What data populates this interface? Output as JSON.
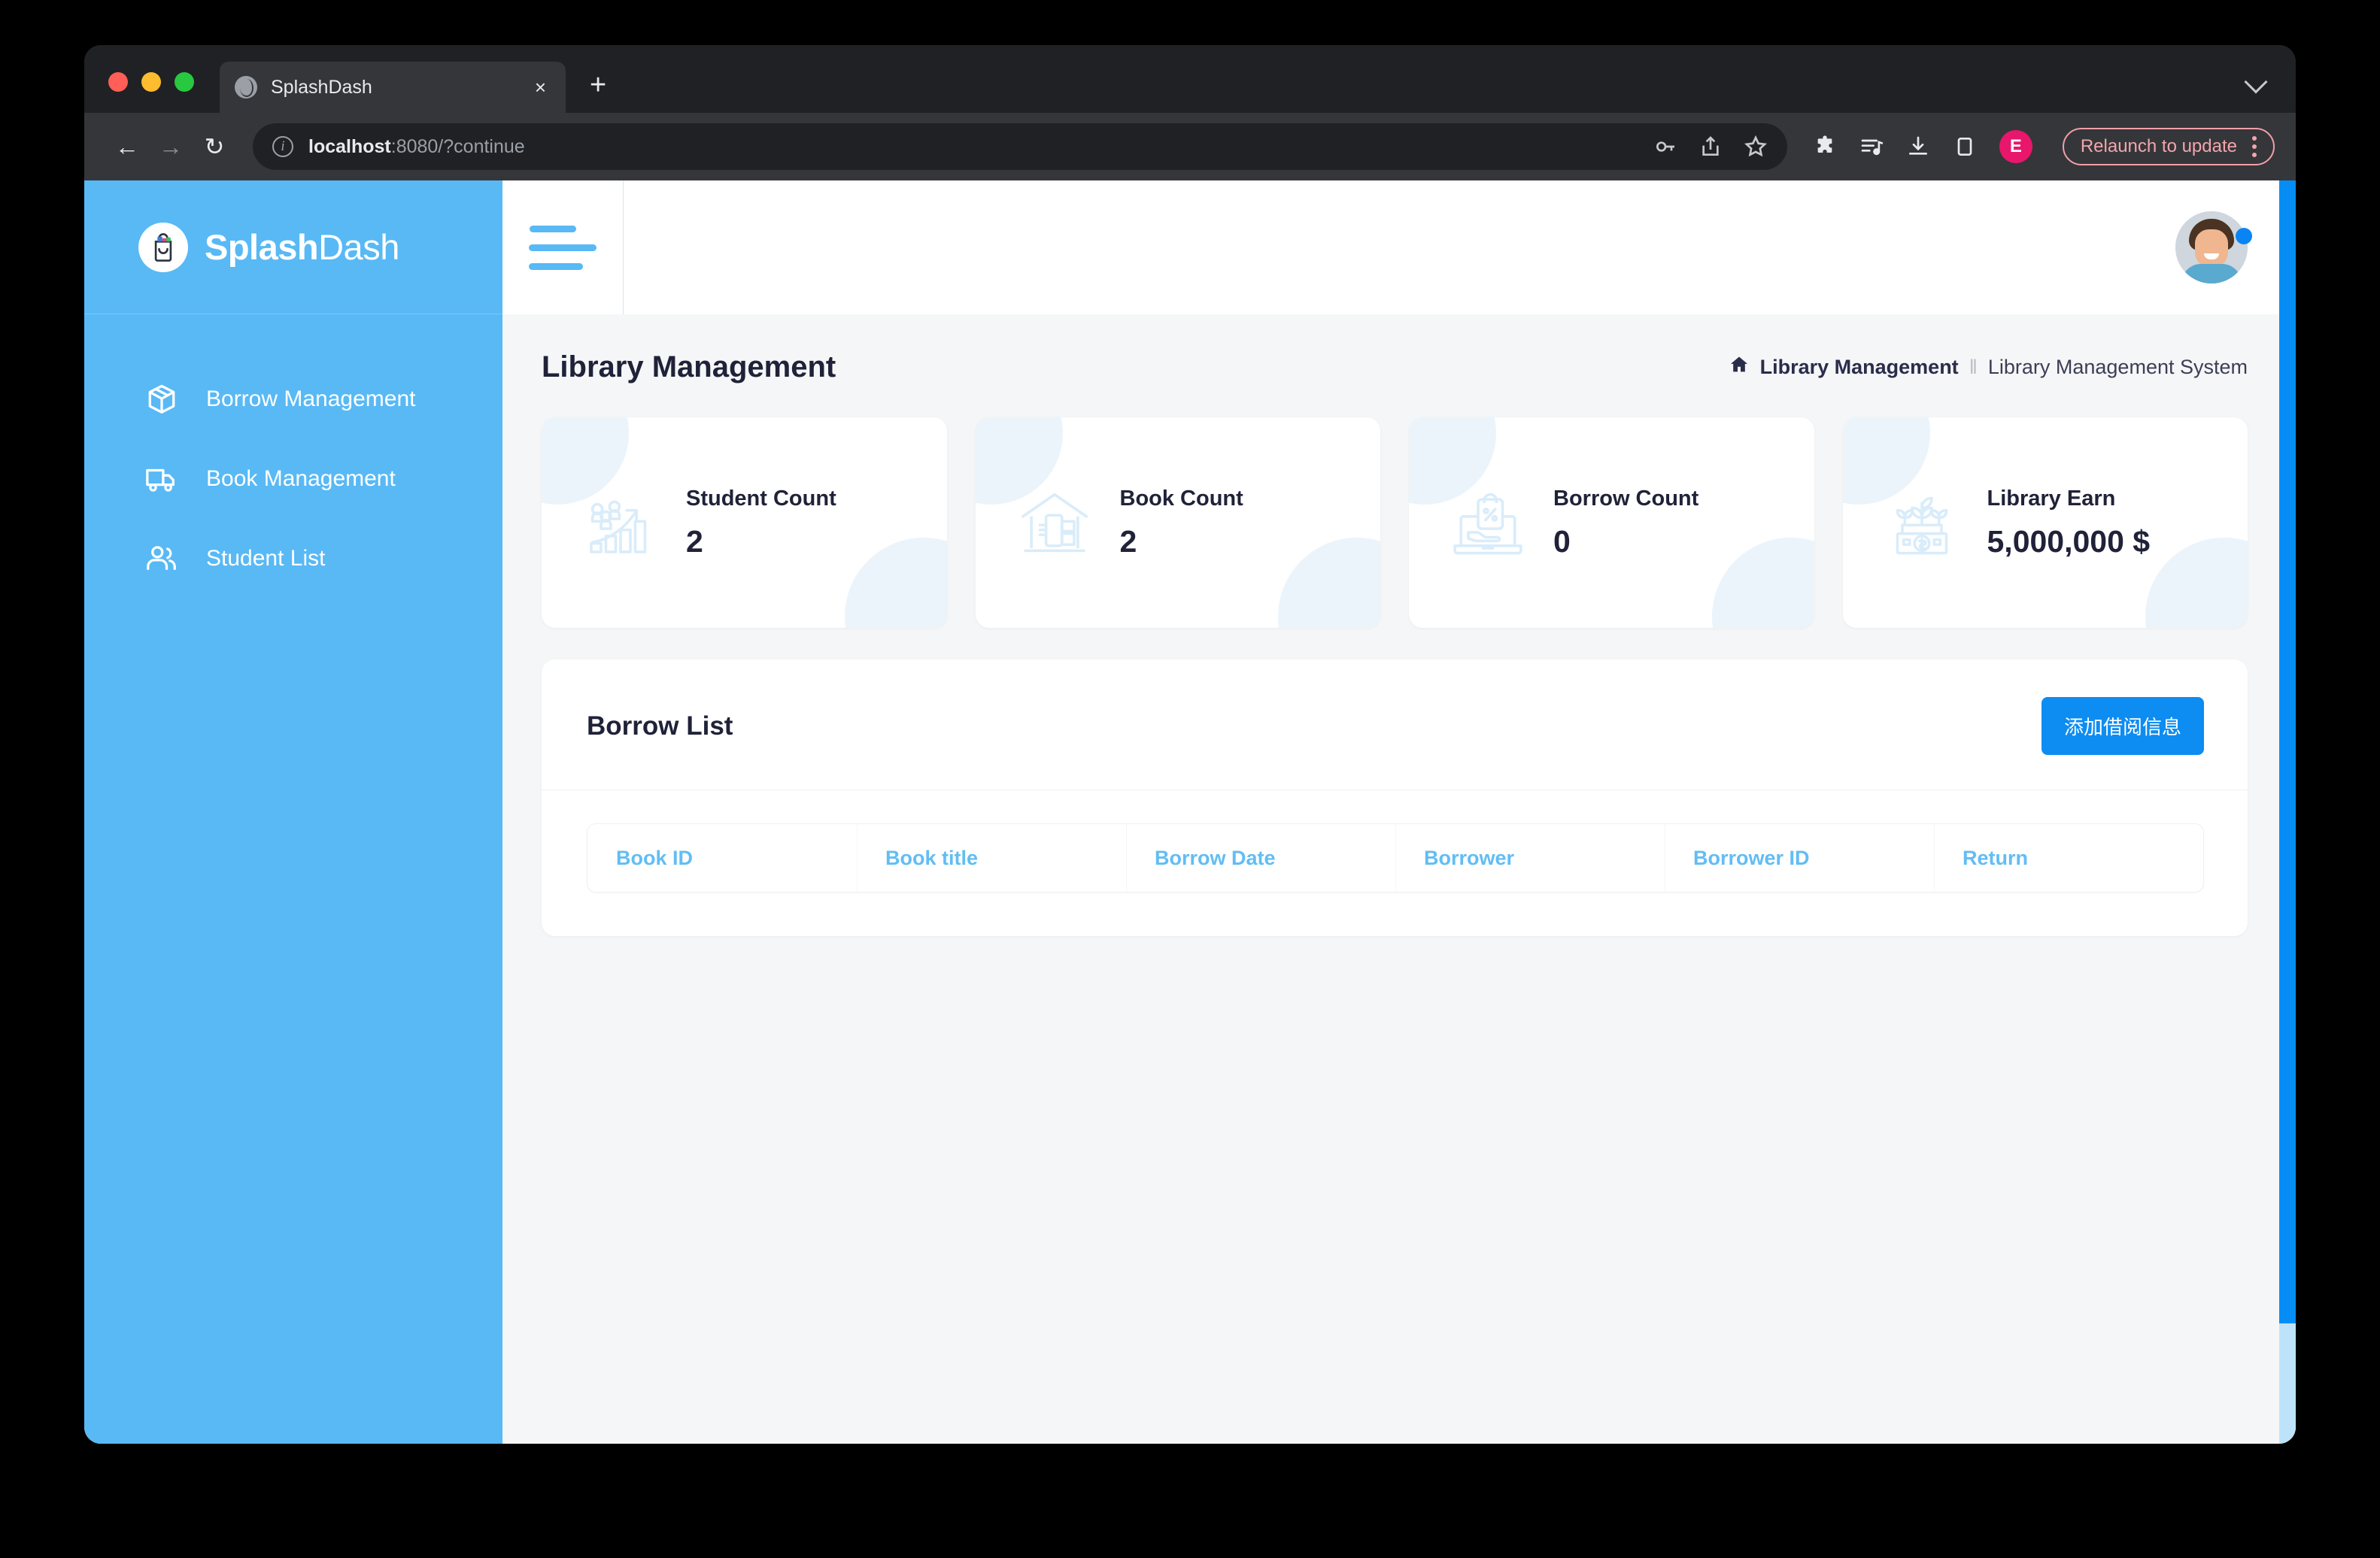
{
  "browser": {
    "tab_title": "SplashDash",
    "tab_close": "×",
    "new_tab": "+",
    "back_icon": "←",
    "forward_icon": "→",
    "reload_icon": "↻",
    "url_host": "localhost",
    "url_rest": ":8080/?continue",
    "profile_initial": "E",
    "relaunch_label": "Relaunch to update",
    "icons": [
      "key-icon",
      "share-icon",
      "star-icon",
      "extensions-icon",
      "reading-list-icon",
      "download-icon",
      "side-panel-icon"
    ]
  },
  "sidebar": {
    "logo_bold": "Splash",
    "logo_light": "Dash",
    "items": [
      {
        "label": "Borrow Management",
        "icon": "package-icon"
      },
      {
        "label": "Book Management",
        "icon": "truck-icon"
      },
      {
        "label": "Student List",
        "icon": "users-icon"
      }
    ]
  },
  "topbar": {
    "menu_icon": "hamburger-icon",
    "avatar": "user-avatar",
    "status": "online"
  },
  "page": {
    "title": "Library Management",
    "breadcrumb": {
      "home_icon": "home-icon",
      "current": "Library Management",
      "separator": "ǁ",
      "parent": "Library Management System"
    }
  },
  "stats": [
    {
      "label": "Student Count",
      "value": "2",
      "icon": "growth-chart-people-icon"
    },
    {
      "label": "Book Count",
      "value": "2",
      "icon": "library-house-book-icon"
    },
    {
      "label": "Borrow Count",
      "value": "0",
      "icon": "laptop-shopping-bag-icon"
    },
    {
      "label": "Library Earn",
      "value": "5,000,000 $",
      "icon": "money-plant-icon"
    }
  ],
  "borrow_list": {
    "title": "Borrow List",
    "add_button": "添加借阅信息",
    "columns": [
      "Book ID",
      "Book title",
      "Borrow Date",
      "Borrower",
      "Borrower ID",
      "Return"
    ],
    "rows": []
  },
  "colors": {
    "sidebar": "#58b9f5",
    "accent": "#0d8cf2",
    "table_header_text": "#62bdf4",
    "text_dark": "#1f2238",
    "card_blob": "#ecf4fb",
    "page_bg": "#f5f6f7"
  }
}
